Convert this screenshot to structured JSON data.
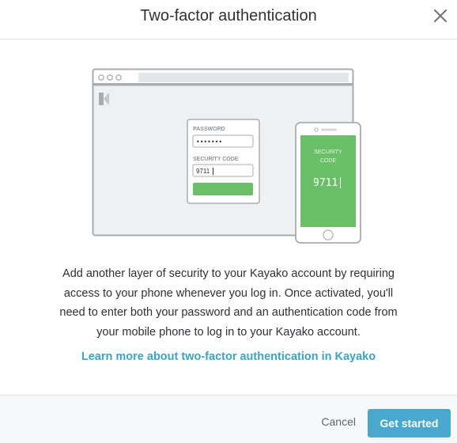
{
  "modal": {
    "title": "Two-factor authentication",
    "close_icon": "close-icon"
  },
  "illustration": {
    "password_label": "PASSWORD",
    "password_mask": "•••••••",
    "security_code_label": "SECURITY CODE",
    "security_code_value": "9711",
    "phone_label_line1": "SECURITY",
    "phone_label_line2": "CODE",
    "phone_code": "9711",
    "accent": "#6bbf68"
  },
  "description": "Add another layer of security to your Kayako account by requiring access to your phone whenever you log in. Once activated, you'll need to enter both your password and an authentication code from your mobile phone to log in to your Kayako account.",
  "learn_more_link": "Learn more about two-factor authentication in Kayako",
  "footer": {
    "cancel_label": "Cancel",
    "primary_label": "Get started",
    "primary_color": "#4aa7ce"
  }
}
